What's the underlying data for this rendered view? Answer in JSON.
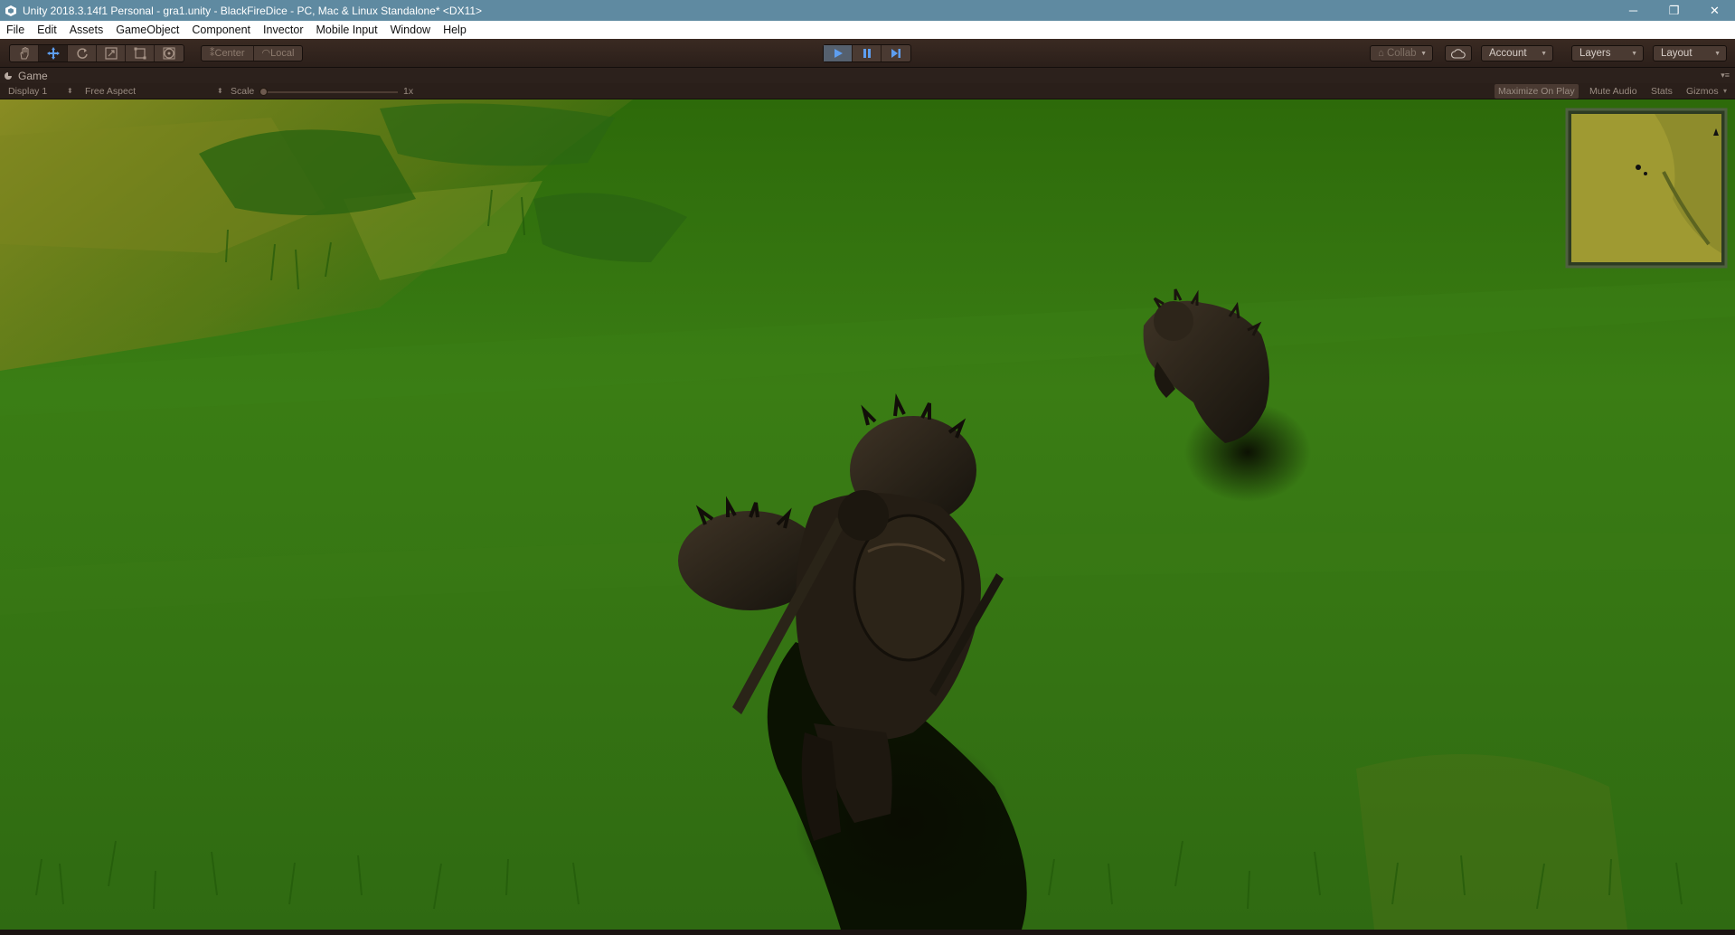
{
  "window": {
    "title": "Unity 2018.3.14f1 Personal - gra1.unity - BlackFireDice - PC, Mac & Linux Standalone* <DX11>",
    "minimize_glyph": "─",
    "restore_glyph": "❐",
    "close_glyph": "✕"
  },
  "menu": {
    "items": [
      "File",
      "Edit",
      "Assets",
      "GameObject",
      "Component",
      "Invector",
      "Mobile Input",
      "Window",
      "Help"
    ]
  },
  "toolbar": {
    "tools": [
      {
        "name": "hand-tool-icon",
        "active": false
      },
      {
        "name": "move-tool-icon",
        "active": true
      },
      {
        "name": "rotate-tool-icon",
        "active": false
      },
      {
        "name": "scale-tool-icon",
        "active": false
      },
      {
        "name": "rect-tool-icon",
        "active": false
      },
      {
        "name": "transform-tool-icon",
        "active": false
      }
    ],
    "pivot_label": "Center",
    "space_label": "Local",
    "play_active": true,
    "collab_label": "Collab",
    "account_label": "Account",
    "layers_label": "Layers",
    "layout_label": "Layout",
    "accent_color": "#5e9ef0"
  },
  "game_tab": {
    "label": "Game"
  },
  "game_bar": {
    "display_label": "Display 1",
    "aspect_label": "Free Aspect",
    "scale_label": "Scale",
    "scale_value": "1x",
    "maximize_label": "Maximize On Play",
    "maximize_on": true,
    "mute_label": "Mute Audio",
    "stats_label": "Stats",
    "gizmos_label": "Gizmos"
  },
  "scene": {
    "grass_color": "#2f6a10",
    "ground_light_color": "#7f8a1e",
    "minimap_present": true,
    "characters": [
      "player-knight",
      "enemy-orc"
    ]
  }
}
